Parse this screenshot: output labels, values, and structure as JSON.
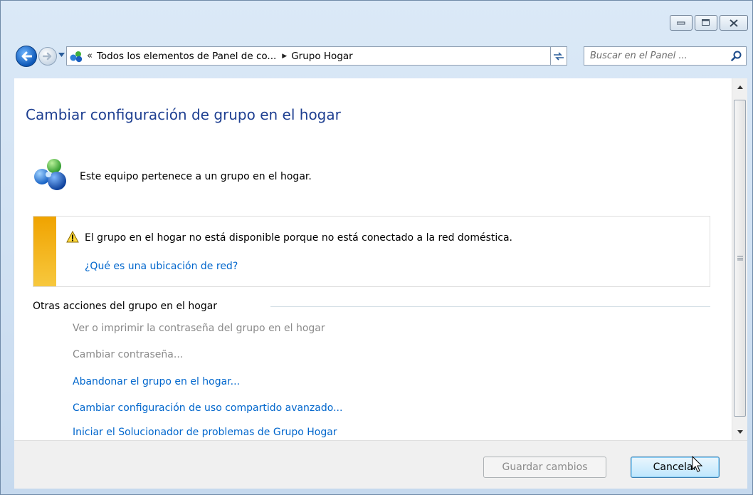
{
  "window": {
    "minimize_icon": "minimize-icon",
    "maximize_icon": "maximize-icon",
    "close_icon": "close-icon"
  },
  "navigation": {
    "back_icon": "back-arrow-icon",
    "forward_icon": "forward-arrow-icon",
    "address": {
      "overflow_chevron": "«",
      "segment_1": "Todos los elementos de Panel de co...",
      "separator": "▶",
      "segment_2": "Grupo Hogar"
    },
    "search": {
      "placeholder": "Buscar en el Panel ..."
    }
  },
  "content": {
    "title": "Cambiar configuración de grupo en el hogar",
    "status": "Este equipo pertenece a un grupo en el hogar.",
    "warning": {
      "message": "El grupo en el hogar no está disponible porque no está conectado a la red doméstica.",
      "link": "¿Qué es una ubicación de red?"
    },
    "other_actions": {
      "header": "Otras acciones del grupo en el hogar",
      "items": [
        {
          "label": "Ver o imprimir la contraseña del grupo en el hogar",
          "enabled": false
        },
        {
          "label": "Cambiar contraseña...",
          "enabled": false
        },
        {
          "label": "Abandonar el grupo en el hogar...",
          "enabled": true
        },
        {
          "label": "Cambiar configuración de uso compartido avanzado...",
          "enabled": true
        },
        {
          "label": "Iniciar el Solucionador de problemas de Grupo Hogar",
          "enabled": true
        }
      ]
    }
  },
  "footer": {
    "save_label": "Guardar cambios",
    "cancel_label": "Cancelar"
  },
  "colors": {
    "title": "#1e3f91",
    "link": "#0066cc",
    "disabled_text": "#8a8a8a",
    "warning_stripe": "#f0a300"
  }
}
